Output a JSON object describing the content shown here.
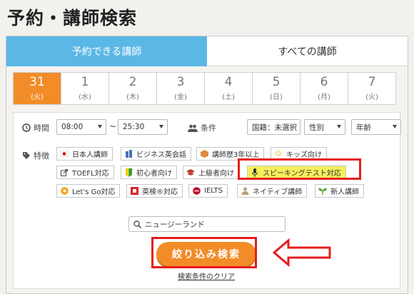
{
  "page_title": "予約・講師検索",
  "tabs": [
    {
      "label": "予約できる講師",
      "active": true
    },
    {
      "label": "すべての講師",
      "active": false
    }
  ],
  "dates": [
    {
      "day": "31",
      "weekday": "(火)",
      "selected": true
    },
    {
      "day": "1",
      "weekday": "(水)"
    },
    {
      "day": "2",
      "weekday": "(木)"
    },
    {
      "day": "3",
      "weekday": "(金)"
    },
    {
      "day": "4",
      "weekday": "(土)"
    },
    {
      "day": "5",
      "weekday": "(日)"
    },
    {
      "day": "6",
      "weekday": "(月)"
    },
    {
      "day": "7",
      "weekday": "(火)"
    }
  ],
  "time": {
    "label": "時間",
    "from": "08:00",
    "separator": "~",
    "to": "25:30"
  },
  "conditions": {
    "label": "条件",
    "nationality": "国籍：未選択",
    "gender": "性別",
    "age": "年齢"
  },
  "features": {
    "label": "特徴",
    "tags": [
      {
        "label": "日本人講師",
        "icon": "japan-flag-icon"
      },
      {
        "label": "ビジネス英会話",
        "icon": "building-icon"
      },
      {
        "label": "講師歴3年以上",
        "icon": "cube-icon"
      },
      {
        "label": "キッズ向け",
        "icon": "smile-icon"
      },
      {
        "label": "TOEFL対応",
        "icon": "external-icon"
      },
      {
        "label": "初心者向け",
        "icon": "beginner-mark-icon"
      },
      {
        "label": "上級者向け",
        "icon": "graduation-cap-icon"
      },
      {
        "label": "スピーキングテスト対応",
        "icon": "microphone-icon",
        "highlighted": true
      },
      {
        "label": "Let's Go対応",
        "icon": "letsgo-icon"
      },
      {
        "label": "英検®対応",
        "icon": "eiken-icon"
      },
      {
        "label": "IELTS",
        "icon": "ielts-icon"
      },
      {
        "label": "ネイティブ講師",
        "icon": "person-icon"
      },
      {
        "label": "新人講師",
        "icon": "sprout-icon"
      }
    ]
  },
  "search": {
    "value": "ニュージーランド"
  },
  "submit_label": "絞り込み検索",
  "clear_label": "検索条件のクリア",
  "colors": {
    "accent_orange": "#f28c28",
    "tab_blue": "#5bb7e6",
    "highlight_yellow": "#f4f05a",
    "annotation_red": "#e51c1c"
  }
}
